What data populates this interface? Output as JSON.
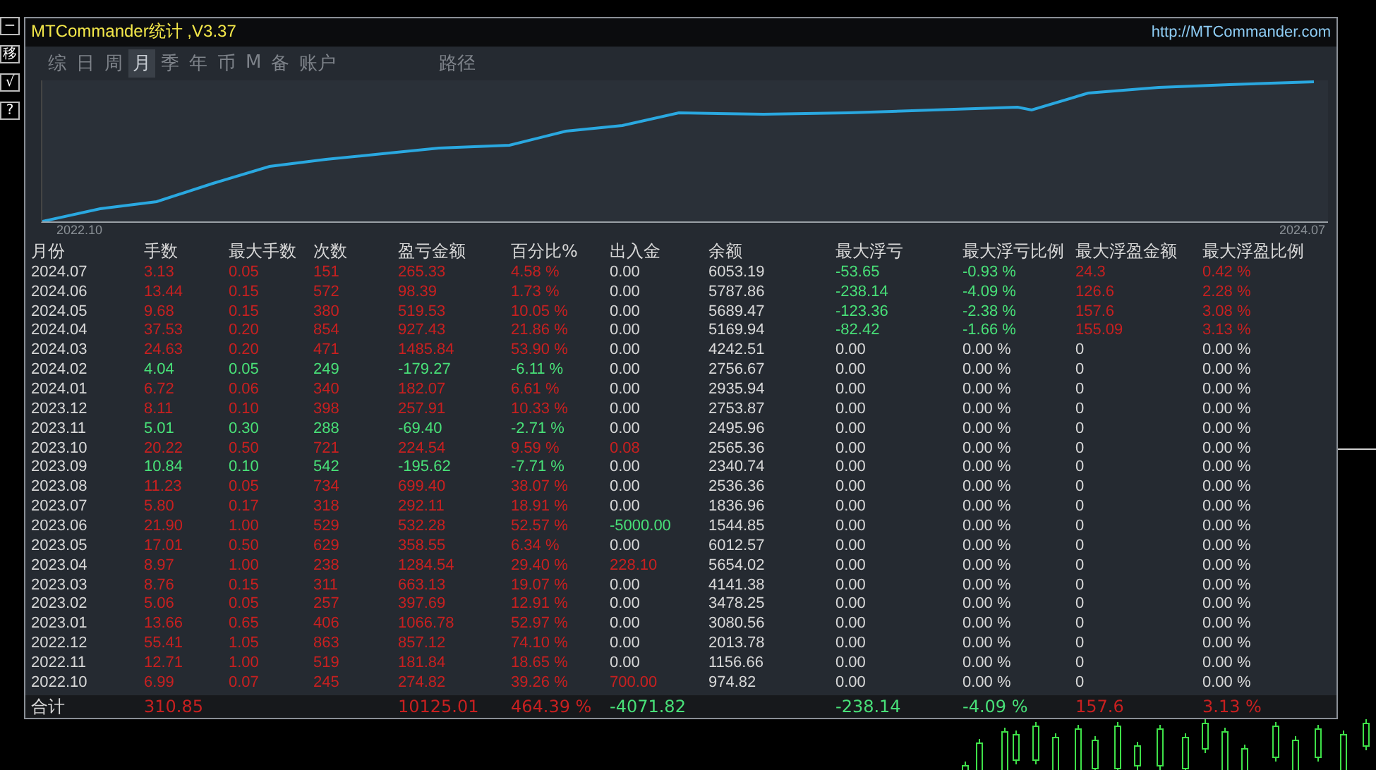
{
  "side_buttons": [
    "−",
    "移",
    "√",
    "?"
  ],
  "window": {
    "title": "MTCommander统计 ,V3.37",
    "url": "http://MTCommander.com"
  },
  "tabs": [
    {
      "label": "综",
      "selected": false
    },
    {
      "label": "日",
      "selected": false
    },
    {
      "label": "周",
      "selected": false
    },
    {
      "label": "月",
      "selected": true
    },
    {
      "label": "季",
      "selected": false
    },
    {
      "label": "年",
      "selected": false
    },
    {
      "label": "币",
      "selected": false
    },
    {
      "label": "M",
      "selected": false
    },
    {
      "label": "备",
      "selected": false
    },
    {
      "label": "账户",
      "selected": false
    }
  ],
  "path_tab": "路径",
  "chart": {
    "start_label": "2022.10",
    "end_label": "2024.07"
  },
  "table": {
    "columns": [
      "月份",
      "手数",
      "最大手数",
      "次数",
      "盈亏金额",
      "百分比%",
      "出入金",
      "余额",
      "最大浮亏",
      "最大浮亏比例",
      "最大浮盈金额",
      "最大浮盈比例"
    ],
    "rows": [
      {
        "cells": [
          {
            "text": "2024.07",
            "color": "#d8d8d8"
          },
          {
            "text": "3.13",
            "color": "#c82020"
          },
          {
            "text": "0.05",
            "color": "#c82020"
          },
          {
            "text": "151",
            "color": "#c82020"
          },
          {
            "text": "265.33",
            "color": "#c82020"
          },
          {
            "text": "4.58 %",
            "color": "#c82020"
          },
          {
            "text": "0.00",
            "color": "#d8d8d8"
          },
          {
            "text": "6053.19",
            "color": "#d8d8d8"
          },
          {
            "text": "-53.65",
            "color": "#48e078"
          },
          {
            "text": "-0.93 %",
            "color": "#48e078"
          },
          {
            "text": "24.3",
            "color": "#c82020"
          },
          {
            "text": "0.42 %",
            "color": "#c82020"
          }
        ]
      },
      {
        "cells": [
          {
            "text": "2024.06",
            "color": "#d8d8d8"
          },
          {
            "text": "13.44",
            "color": "#c82020"
          },
          {
            "text": "0.15",
            "color": "#c82020"
          },
          {
            "text": "572",
            "color": "#c82020"
          },
          {
            "text": "98.39",
            "color": "#c82020"
          },
          {
            "text": "1.73 %",
            "color": "#c82020"
          },
          {
            "text": "0.00",
            "color": "#d8d8d8"
          },
          {
            "text": "5787.86",
            "color": "#d8d8d8"
          },
          {
            "text": "-238.14",
            "color": "#48e078"
          },
          {
            "text": "-4.09 %",
            "color": "#48e078"
          },
          {
            "text": "126.6",
            "color": "#c82020"
          },
          {
            "text": "2.28 %",
            "color": "#c82020"
          }
        ]
      },
      {
        "cells": [
          {
            "text": "2024.05",
            "color": "#d8d8d8"
          },
          {
            "text": "9.68",
            "color": "#c82020"
          },
          {
            "text": "0.15",
            "color": "#c82020"
          },
          {
            "text": "380",
            "color": "#c82020"
          },
          {
            "text": "519.53",
            "color": "#c82020"
          },
          {
            "text": "10.05 %",
            "color": "#c82020"
          },
          {
            "text": "0.00",
            "color": "#d8d8d8"
          },
          {
            "text": "5689.47",
            "color": "#d8d8d8"
          },
          {
            "text": "-123.36",
            "color": "#48e078"
          },
          {
            "text": "-2.38 %",
            "color": "#48e078"
          },
          {
            "text": "157.6",
            "color": "#c82020"
          },
          {
            "text": "3.08 %",
            "color": "#c82020"
          }
        ]
      },
      {
        "cells": [
          {
            "text": "2024.04",
            "color": "#d8d8d8"
          },
          {
            "text": "37.53",
            "color": "#c82020"
          },
          {
            "text": "0.20",
            "color": "#c82020"
          },
          {
            "text": "854",
            "color": "#c82020"
          },
          {
            "text": "927.43",
            "color": "#c82020"
          },
          {
            "text": "21.86 %",
            "color": "#c82020"
          },
          {
            "text": "0.00",
            "color": "#d8d8d8"
          },
          {
            "text": "5169.94",
            "color": "#d8d8d8"
          },
          {
            "text": "-82.42",
            "color": "#48e078"
          },
          {
            "text": "-1.66 %",
            "color": "#48e078"
          },
          {
            "text": "155.09",
            "color": "#c82020"
          },
          {
            "text": "3.13 %",
            "color": "#c82020"
          }
        ]
      },
      {
        "cells": [
          {
            "text": "2024.03",
            "color": "#d8d8d8"
          },
          {
            "text": "24.63",
            "color": "#c82020"
          },
          {
            "text": "0.20",
            "color": "#c82020"
          },
          {
            "text": "471",
            "color": "#c82020"
          },
          {
            "text": "1485.84",
            "color": "#c82020"
          },
          {
            "text": "53.90 %",
            "color": "#c82020"
          },
          {
            "text": "0.00",
            "color": "#d8d8d8"
          },
          {
            "text": "4242.51",
            "color": "#d8d8d8"
          },
          {
            "text": "0.00",
            "color": "#d8d8d8"
          },
          {
            "text": "0.00 %",
            "color": "#d8d8d8"
          },
          {
            "text": "0",
            "color": "#d8d8d8"
          },
          {
            "text": "0.00 %",
            "color": "#d8d8d8"
          }
        ]
      },
      {
        "cells": [
          {
            "text": "2024.02",
            "color": "#d8d8d8"
          },
          {
            "text": "4.04",
            "color": "#48e078"
          },
          {
            "text": "0.05",
            "color": "#48e078"
          },
          {
            "text": "249",
            "color": "#48e078"
          },
          {
            "text": "-179.27",
            "color": "#48e078"
          },
          {
            "text": "-6.11 %",
            "color": "#48e078"
          },
          {
            "text": "0.00",
            "color": "#d8d8d8"
          },
          {
            "text": "2756.67",
            "color": "#d8d8d8"
          },
          {
            "text": "0.00",
            "color": "#d8d8d8"
          },
          {
            "text": "0.00 %",
            "color": "#d8d8d8"
          },
          {
            "text": "0",
            "color": "#d8d8d8"
          },
          {
            "text": "0.00 %",
            "color": "#d8d8d8"
          }
        ]
      },
      {
        "cells": [
          {
            "text": "2024.01",
            "color": "#d8d8d8"
          },
          {
            "text": "6.72",
            "color": "#c82020"
          },
          {
            "text": "0.06",
            "color": "#c82020"
          },
          {
            "text": "340",
            "color": "#c82020"
          },
          {
            "text": "182.07",
            "color": "#c82020"
          },
          {
            "text": "6.61 %",
            "color": "#c82020"
          },
          {
            "text": "0.00",
            "color": "#d8d8d8"
          },
          {
            "text": "2935.94",
            "color": "#d8d8d8"
          },
          {
            "text": "0.00",
            "color": "#d8d8d8"
          },
          {
            "text": "0.00 %",
            "color": "#d8d8d8"
          },
          {
            "text": "0",
            "color": "#d8d8d8"
          },
          {
            "text": "0.00 %",
            "color": "#d8d8d8"
          }
        ]
      },
      {
        "cells": [
          {
            "text": "2023.12",
            "color": "#d8d8d8"
          },
          {
            "text": "8.11",
            "color": "#c82020"
          },
          {
            "text": "0.10",
            "color": "#c82020"
          },
          {
            "text": "398",
            "color": "#c82020"
          },
          {
            "text": "257.91",
            "color": "#c82020"
          },
          {
            "text": "10.33 %",
            "color": "#c82020"
          },
          {
            "text": "0.00",
            "color": "#d8d8d8"
          },
          {
            "text": "2753.87",
            "color": "#d8d8d8"
          },
          {
            "text": "0.00",
            "color": "#d8d8d8"
          },
          {
            "text": "0.00 %",
            "color": "#d8d8d8"
          },
          {
            "text": "0",
            "color": "#d8d8d8"
          },
          {
            "text": "0.00 %",
            "color": "#d8d8d8"
          }
        ]
      },
      {
        "cells": [
          {
            "text": "2023.11",
            "color": "#d8d8d8"
          },
          {
            "text": "5.01",
            "color": "#48e078"
          },
          {
            "text": "0.30",
            "color": "#48e078"
          },
          {
            "text": "288",
            "color": "#48e078"
          },
          {
            "text": "-69.40",
            "color": "#48e078"
          },
          {
            "text": "-2.71 %",
            "color": "#48e078"
          },
          {
            "text": "0.00",
            "color": "#d8d8d8"
          },
          {
            "text": "2495.96",
            "color": "#d8d8d8"
          },
          {
            "text": "0.00",
            "color": "#d8d8d8"
          },
          {
            "text": "0.00 %",
            "color": "#d8d8d8"
          },
          {
            "text": "0",
            "color": "#d8d8d8"
          },
          {
            "text": "0.00 %",
            "color": "#d8d8d8"
          }
        ]
      },
      {
        "cells": [
          {
            "text": "2023.10",
            "color": "#d8d8d8"
          },
          {
            "text": "20.22",
            "color": "#c82020"
          },
          {
            "text": "0.50",
            "color": "#c82020"
          },
          {
            "text": "721",
            "color": "#c82020"
          },
          {
            "text": "224.54",
            "color": "#c82020"
          },
          {
            "text": "9.59 %",
            "color": "#c82020"
          },
          {
            "text": "0.08",
            "color": "#c82020"
          },
          {
            "text": "2565.36",
            "color": "#d8d8d8"
          },
          {
            "text": "0.00",
            "color": "#d8d8d8"
          },
          {
            "text": "0.00 %",
            "color": "#d8d8d8"
          },
          {
            "text": "0",
            "color": "#d8d8d8"
          },
          {
            "text": "0.00 %",
            "color": "#d8d8d8"
          }
        ]
      },
      {
        "cells": [
          {
            "text": "2023.09",
            "color": "#d8d8d8"
          },
          {
            "text": "10.84",
            "color": "#48e078"
          },
          {
            "text": "0.10",
            "color": "#48e078"
          },
          {
            "text": "542",
            "color": "#48e078"
          },
          {
            "text": "-195.62",
            "color": "#48e078"
          },
          {
            "text": "-7.71 %",
            "color": "#48e078"
          },
          {
            "text": "0.00",
            "color": "#d8d8d8"
          },
          {
            "text": "2340.74",
            "color": "#d8d8d8"
          },
          {
            "text": "0.00",
            "color": "#d8d8d8"
          },
          {
            "text": "0.00 %",
            "color": "#d8d8d8"
          },
          {
            "text": "0",
            "color": "#d8d8d8"
          },
          {
            "text": "0.00 %",
            "color": "#d8d8d8"
          }
        ]
      },
      {
        "cells": [
          {
            "text": "2023.08",
            "color": "#d8d8d8"
          },
          {
            "text": "11.23",
            "color": "#c82020"
          },
          {
            "text": "0.05",
            "color": "#c82020"
          },
          {
            "text": "734",
            "color": "#c82020"
          },
          {
            "text": "699.40",
            "color": "#c82020"
          },
          {
            "text": "38.07 %",
            "color": "#c82020"
          },
          {
            "text": "0.00",
            "color": "#d8d8d8"
          },
          {
            "text": "2536.36",
            "color": "#d8d8d8"
          },
          {
            "text": "0.00",
            "color": "#d8d8d8"
          },
          {
            "text": "0.00 %",
            "color": "#d8d8d8"
          },
          {
            "text": "0",
            "color": "#d8d8d8"
          },
          {
            "text": "0.00 %",
            "color": "#d8d8d8"
          }
        ]
      },
      {
        "cells": [
          {
            "text": "2023.07",
            "color": "#d8d8d8"
          },
          {
            "text": "5.80",
            "color": "#c82020"
          },
          {
            "text": "0.17",
            "color": "#c82020"
          },
          {
            "text": "318",
            "color": "#c82020"
          },
          {
            "text": "292.11",
            "color": "#c82020"
          },
          {
            "text": "18.91 %",
            "color": "#c82020"
          },
          {
            "text": "0.00",
            "color": "#d8d8d8"
          },
          {
            "text": "1836.96",
            "color": "#d8d8d8"
          },
          {
            "text": "0.00",
            "color": "#d8d8d8"
          },
          {
            "text": "0.00 %",
            "color": "#d8d8d8"
          },
          {
            "text": "0",
            "color": "#d8d8d8"
          },
          {
            "text": "0.00 %",
            "color": "#d8d8d8"
          }
        ]
      },
      {
        "cells": [
          {
            "text": "2023.06",
            "color": "#d8d8d8"
          },
          {
            "text": "21.90",
            "color": "#c82020"
          },
          {
            "text": "1.00",
            "color": "#c82020"
          },
          {
            "text": "529",
            "color": "#c82020"
          },
          {
            "text": "532.28",
            "color": "#c82020"
          },
          {
            "text": "52.57 %",
            "color": "#c82020"
          },
          {
            "text": "-5000.00",
            "color": "#48e078"
          },
          {
            "text": "1544.85",
            "color": "#d8d8d8"
          },
          {
            "text": "0.00",
            "color": "#d8d8d8"
          },
          {
            "text": "0.00 %",
            "color": "#d8d8d8"
          },
          {
            "text": "0",
            "color": "#d8d8d8"
          },
          {
            "text": "0.00 %",
            "color": "#d8d8d8"
          }
        ]
      },
      {
        "cells": [
          {
            "text": "2023.05",
            "color": "#d8d8d8"
          },
          {
            "text": "17.01",
            "color": "#c82020"
          },
          {
            "text": "0.50",
            "color": "#c82020"
          },
          {
            "text": "629",
            "color": "#c82020"
          },
          {
            "text": "358.55",
            "color": "#c82020"
          },
          {
            "text": "6.34 %",
            "color": "#c82020"
          },
          {
            "text": "0.00",
            "color": "#d8d8d8"
          },
          {
            "text": "6012.57",
            "color": "#d8d8d8"
          },
          {
            "text": "0.00",
            "color": "#d8d8d8"
          },
          {
            "text": "0.00 %",
            "color": "#d8d8d8"
          },
          {
            "text": "0",
            "color": "#d8d8d8"
          },
          {
            "text": "0.00 %",
            "color": "#d8d8d8"
          }
        ]
      },
      {
        "cells": [
          {
            "text": "2023.04",
            "color": "#d8d8d8"
          },
          {
            "text": "8.97",
            "color": "#c82020"
          },
          {
            "text": "1.00",
            "color": "#c82020"
          },
          {
            "text": "238",
            "color": "#c82020"
          },
          {
            "text": "1284.54",
            "color": "#c82020"
          },
          {
            "text": "29.40 %",
            "color": "#c82020"
          },
          {
            "text": "228.10",
            "color": "#c82020"
          },
          {
            "text": "5654.02",
            "color": "#d8d8d8"
          },
          {
            "text": "0.00",
            "color": "#d8d8d8"
          },
          {
            "text": "0.00 %",
            "color": "#d8d8d8"
          },
          {
            "text": "0",
            "color": "#d8d8d8"
          },
          {
            "text": "0.00 %",
            "color": "#d8d8d8"
          }
        ]
      },
      {
        "cells": [
          {
            "text": "2023.03",
            "color": "#d8d8d8"
          },
          {
            "text": "8.76",
            "color": "#c82020"
          },
          {
            "text": "0.15",
            "color": "#c82020"
          },
          {
            "text": "311",
            "color": "#c82020"
          },
          {
            "text": "663.13",
            "color": "#c82020"
          },
          {
            "text": "19.07 %",
            "color": "#c82020"
          },
          {
            "text": "0.00",
            "color": "#d8d8d8"
          },
          {
            "text": "4141.38",
            "color": "#d8d8d8"
          },
          {
            "text": "0.00",
            "color": "#d8d8d8"
          },
          {
            "text": "0.00 %",
            "color": "#d8d8d8"
          },
          {
            "text": "0",
            "color": "#d8d8d8"
          },
          {
            "text": "0.00 %",
            "color": "#d8d8d8"
          }
        ]
      },
      {
        "cells": [
          {
            "text": "2023.02",
            "color": "#d8d8d8"
          },
          {
            "text": "5.06",
            "color": "#c82020"
          },
          {
            "text": "0.05",
            "color": "#c82020"
          },
          {
            "text": "257",
            "color": "#c82020"
          },
          {
            "text": "397.69",
            "color": "#c82020"
          },
          {
            "text": "12.91 %",
            "color": "#c82020"
          },
          {
            "text": "0.00",
            "color": "#d8d8d8"
          },
          {
            "text": "3478.25",
            "color": "#d8d8d8"
          },
          {
            "text": "0.00",
            "color": "#d8d8d8"
          },
          {
            "text": "0.00 %",
            "color": "#d8d8d8"
          },
          {
            "text": "0",
            "color": "#d8d8d8"
          },
          {
            "text": "0.00 %",
            "color": "#d8d8d8"
          }
        ]
      },
      {
        "cells": [
          {
            "text": "2023.01",
            "color": "#d8d8d8"
          },
          {
            "text": "13.66",
            "color": "#c82020"
          },
          {
            "text": "0.65",
            "color": "#c82020"
          },
          {
            "text": "406",
            "color": "#c82020"
          },
          {
            "text": "1066.78",
            "color": "#c82020"
          },
          {
            "text": "52.97 %",
            "color": "#c82020"
          },
          {
            "text": "0.00",
            "color": "#d8d8d8"
          },
          {
            "text": "3080.56",
            "color": "#d8d8d8"
          },
          {
            "text": "0.00",
            "color": "#d8d8d8"
          },
          {
            "text": "0.00 %",
            "color": "#d8d8d8"
          },
          {
            "text": "0",
            "color": "#d8d8d8"
          },
          {
            "text": "0.00 %",
            "color": "#d8d8d8"
          }
        ]
      },
      {
        "cells": [
          {
            "text": "2022.12",
            "color": "#d8d8d8"
          },
          {
            "text": "55.41",
            "color": "#c82020"
          },
          {
            "text": "1.05",
            "color": "#c82020"
          },
          {
            "text": "863",
            "color": "#c82020"
          },
          {
            "text": "857.12",
            "color": "#c82020"
          },
          {
            "text": "74.10 %",
            "color": "#c82020"
          },
          {
            "text": "0.00",
            "color": "#d8d8d8"
          },
          {
            "text": "2013.78",
            "color": "#d8d8d8"
          },
          {
            "text": "0.00",
            "color": "#d8d8d8"
          },
          {
            "text": "0.00 %",
            "color": "#d8d8d8"
          },
          {
            "text": "0",
            "color": "#d8d8d8"
          },
          {
            "text": "0.00 %",
            "color": "#d8d8d8"
          }
        ]
      },
      {
        "cells": [
          {
            "text": "2022.11",
            "color": "#d8d8d8"
          },
          {
            "text": "12.71",
            "color": "#c82020"
          },
          {
            "text": "1.00",
            "color": "#c82020"
          },
          {
            "text": "519",
            "color": "#c82020"
          },
          {
            "text": "181.84",
            "color": "#c82020"
          },
          {
            "text": "18.65 %",
            "color": "#c82020"
          },
          {
            "text": "0.00",
            "color": "#d8d8d8"
          },
          {
            "text": "1156.66",
            "color": "#d8d8d8"
          },
          {
            "text": "0.00",
            "color": "#d8d8d8"
          },
          {
            "text": "0.00 %",
            "color": "#d8d8d8"
          },
          {
            "text": "0",
            "color": "#d8d8d8"
          },
          {
            "text": "0.00 %",
            "color": "#d8d8d8"
          }
        ]
      },
      {
        "cells": [
          {
            "text": "2022.10",
            "color": "#d8d8d8"
          },
          {
            "text": "6.99",
            "color": "#c82020"
          },
          {
            "text": "0.07",
            "color": "#c82020"
          },
          {
            "text": "245",
            "color": "#c82020"
          },
          {
            "text": "274.82",
            "color": "#c82020"
          },
          {
            "text": "39.26 %",
            "color": "#c82020"
          },
          {
            "text": "700.00",
            "color": "#c82020"
          },
          {
            "text": "974.82",
            "color": "#d8d8d8"
          },
          {
            "text": "0.00",
            "color": "#d8d8d8"
          },
          {
            "text": "0.00 %",
            "color": "#d8d8d8"
          },
          {
            "text": "0",
            "color": "#d8d8d8"
          },
          {
            "text": "0.00 %",
            "color": "#d8d8d8"
          }
        ]
      }
    ],
    "total": {
      "label": {
        "text": "合计",
        "color": "#d8d8d8"
      },
      "lots": {
        "text": "310.85",
        "color": "#c82020"
      },
      "profit": {
        "text": "10125.01",
        "color": "#c82020"
      },
      "percent": {
        "text": "464.39 %",
        "color": "#c82020"
      },
      "deposits": {
        "text": "-4071.82",
        "color": "#48e078"
      },
      "max_floating_loss": {
        "text": "-238.14",
        "color": "#48e078"
      },
      "max_floating_loss_ratio": {
        "text": "-4.09 %",
        "color": "#48e078"
      },
      "max_floating_profit": {
        "text": "157.6",
        "color": "#c82020"
      },
      "max_floating_profit_ratio": {
        "text": "3.13 %",
        "color": "#c82020"
      }
    }
  }
}
